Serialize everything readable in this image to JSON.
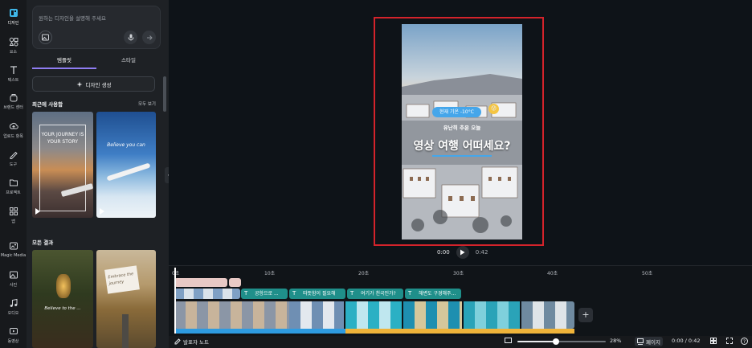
{
  "sidebar": {
    "items": [
      {
        "label": "디자인",
        "icon": "design-icon"
      },
      {
        "label": "요소",
        "icon": "elements-icon"
      },
      {
        "label": "텍스트",
        "icon": "text-icon"
      },
      {
        "label": "브랜드 센터",
        "icon": "brand-icon"
      },
      {
        "label": "업로드 항목",
        "icon": "upload-icon"
      },
      {
        "label": "도구",
        "icon": "draw-icon"
      },
      {
        "label": "프로젝트",
        "icon": "folder-icon"
      },
      {
        "label": "앱",
        "icon": "apps-icon"
      },
      {
        "label": "Magic Media",
        "icon": "magic-media-icon"
      },
      {
        "label": "사진",
        "icon": "photo-icon"
      },
      {
        "label": "오디오",
        "icon": "audio-icon"
      },
      {
        "label": "동영상",
        "icon": "video-icon"
      }
    ]
  },
  "panel": {
    "prompt_placeholder": "원하는 디자인을 설명해 주세요",
    "tabs": [
      "템플릿",
      "스타일"
    ],
    "generate_label": "디자인 생성",
    "recent_title": "최근에 사용함",
    "see_all": "모두 보기",
    "all_results_title": "모든 결과",
    "recent_templates": [
      {
        "text": "YOUR JOURNEY IS YOUR STORY"
      },
      {
        "text": "Believe you can"
      }
    ],
    "result_templates": [
      {
        "text": "Believe to the ..."
      },
      {
        "text": "Embrace the journey"
      }
    ]
  },
  "canvas": {
    "pill_text": "현재 기온 -10°C",
    "subheading": "유난히 추운 오늘",
    "headline": "영상 여행 어떠세요?",
    "time_current": "0:00",
    "time_total": "0:42"
  },
  "timeline": {
    "ruler": [
      "0초",
      "10초",
      "20초",
      "30초",
      "40초",
      "50초"
    ],
    "text_clips": [
      "공항으로 ...",
      "따뜻함이 필요해",
      "여기가 천국인가?",
      "해변도 구경해주..."
    ]
  },
  "bottom": {
    "notes": "발표자 노트",
    "zoom": "28%",
    "zoom_level": 0.28,
    "pages": "페이지",
    "time": "0:00 / 0:42"
  },
  "colors": {
    "selection": "#d4232b",
    "accent": "#8f7df2",
    "text_clip": "#1f8f8a",
    "pill": "#45a6ea"
  }
}
